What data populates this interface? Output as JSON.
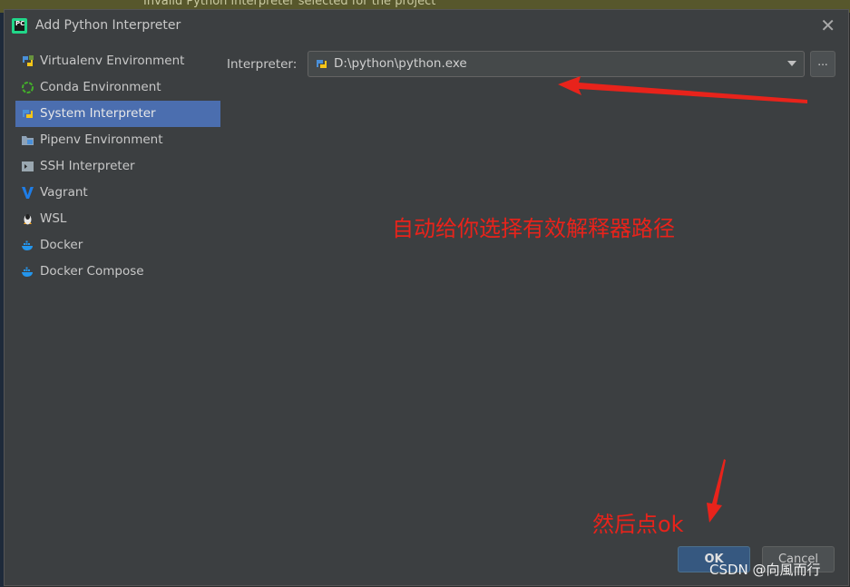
{
  "background": {
    "banner_text": "Invalid Python interpreter selected for the project"
  },
  "dialog": {
    "title": "Add Python Interpreter",
    "close_label": "✕"
  },
  "sidebar": {
    "items": [
      {
        "label": "Virtualenv Environment",
        "icon": "virtualenv-icon",
        "active": false
      },
      {
        "label": "Conda Environment",
        "icon": "conda-icon",
        "active": false
      },
      {
        "label": "System Interpreter",
        "icon": "python-icon",
        "active": true
      },
      {
        "label": "Pipenv Environment",
        "icon": "pipenv-icon",
        "active": false
      },
      {
        "label": "SSH Interpreter",
        "icon": "ssh-icon",
        "active": false
      },
      {
        "label": "Vagrant",
        "icon": "vagrant-icon",
        "active": false
      },
      {
        "label": "WSL",
        "icon": "linux-penguin-icon",
        "active": false
      },
      {
        "label": "Docker",
        "icon": "docker-icon",
        "active": false
      },
      {
        "label": "Docker Compose",
        "icon": "docker-compose-icon",
        "active": false
      }
    ]
  },
  "interpreter": {
    "label": "Interpreter:",
    "value": "D:\\python\\python.exe",
    "browse_label": "..."
  },
  "annotations": {
    "note_1": "自动给你选择有效解释器路径",
    "note_2": "然后点ok"
  },
  "buttons": {
    "ok": "OK",
    "cancel": "Cancel"
  },
  "watermark": "CSDN @向風而行",
  "colors": {
    "dialog_bg": "#3c3f41",
    "selection": "#4b6eaf",
    "annotation_red": "#e8231b",
    "ok_button": "#365880"
  }
}
